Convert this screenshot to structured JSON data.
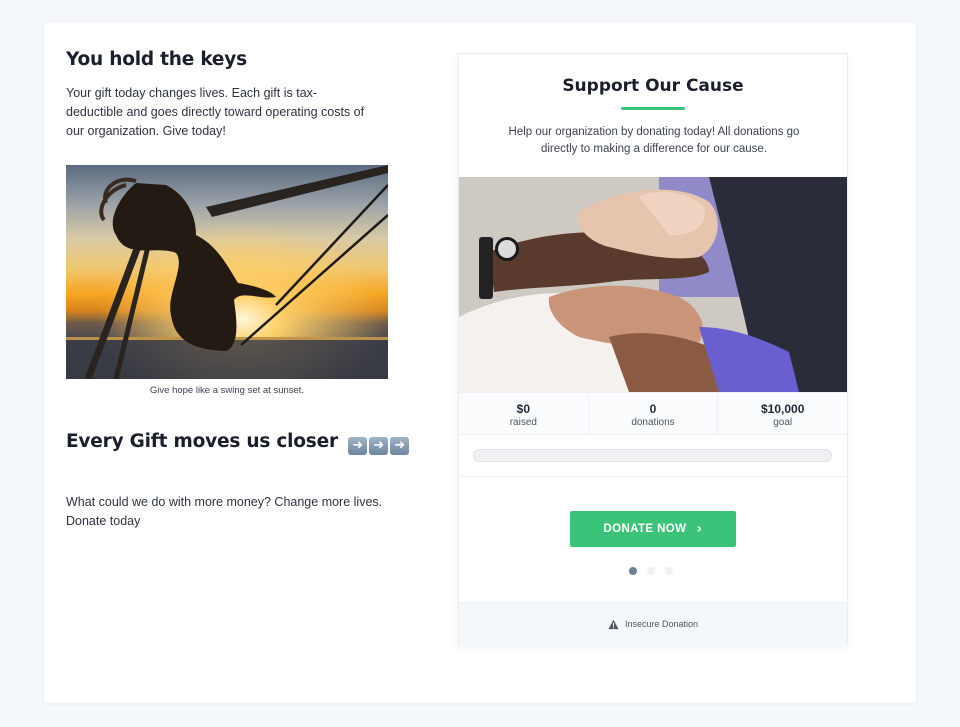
{
  "left": {
    "heading": "You hold the keys",
    "intro": "Your gift today changes lives. Each gift is tax-deductible and goes directly toward operating costs of our organization. Give today!",
    "image_caption": "Give hope like a swing set at sunset.",
    "heading2": "Every Gift moves us closer",
    "heading2_icons": [
      "right-arrow-emoji",
      "right-arrow-emoji",
      "right-arrow-emoji"
    ],
    "outro": "What could we do with more money? Change more lives. Donate today"
  },
  "widget": {
    "title": "Support Our Cause",
    "description": "Help our organization by donating today! All donations go directly to making a difference for our cause.",
    "stats": [
      {
        "value": "$0",
        "label": "raised"
      },
      {
        "value": "0",
        "label": "donations"
      },
      {
        "value": "$10,000",
        "label": "goal"
      }
    ],
    "progress_fraction": 0,
    "donate_label": "DONATE NOW",
    "donate_icon": "chevron-right-icon",
    "carousel_active": 0,
    "carousel_count": 3,
    "footer_text": "Insecure Donation",
    "footer_icon": "warning-icon"
  },
  "colors": {
    "accent": "#3cc37a",
    "page_bg": "#f5f8fb",
    "heading": "#1a1f2b"
  }
}
